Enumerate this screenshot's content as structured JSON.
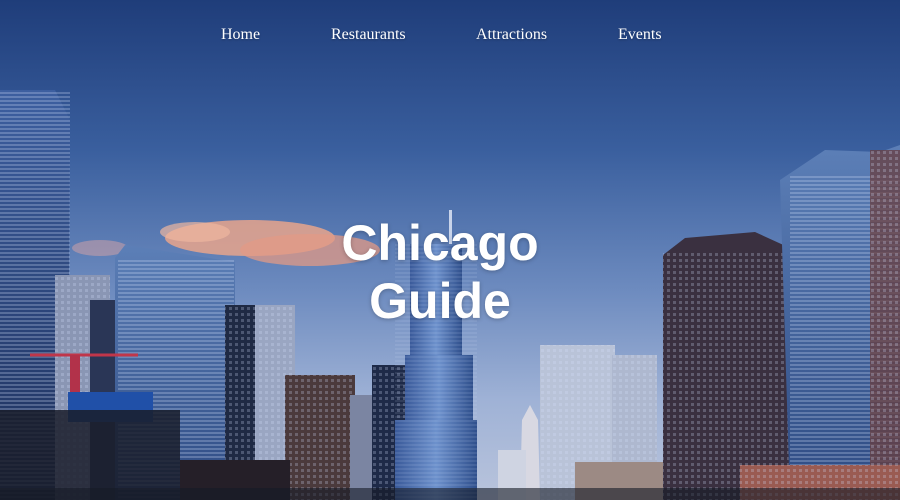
{
  "nav": {
    "items": [
      {
        "label": "Home"
      },
      {
        "label": "Restaurants"
      },
      {
        "label": "Attractions"
      },
      {
        "label": "Events"
      }
    ]
  },
  "hero": {
    "title_line1": "Chicago",
    "title_line2": "Guide"
  },
  "colors": {
    "sky_top": "#1f3d7a",
    "sky_bottom": "#b9c4dc",
    "text": "#ffffff",
    "cloud": "#e7a48c"
  }
}
